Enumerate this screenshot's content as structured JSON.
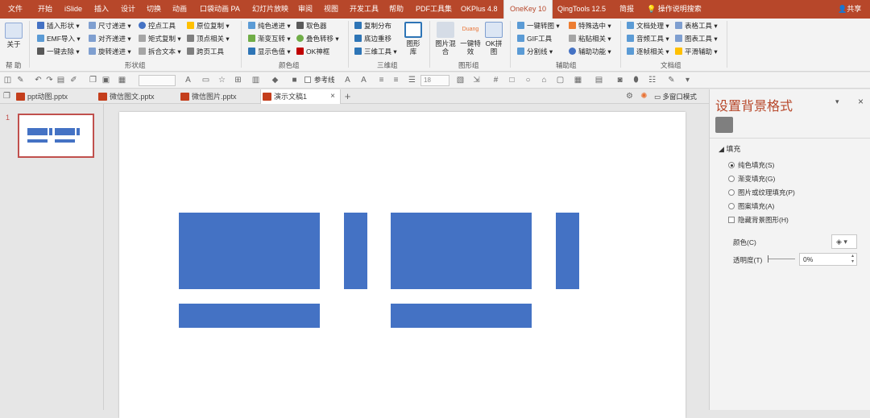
{
  "ribbon_tabs": [
    "文件",
    "开始",
    "iSlide",
    "插入",
    "设计",
    "切换",
    "动画",
    "口袋动画 PA",
    "幻灯片放映",
    "审阅",
    "视图",
    "开发工具",
    "帮助",
    "PDF工具集",
    "OKPlus 4.8",
    "OneKey 10",
    "QingTools 12.5",
    "简报"
  ],
  "active_tab": "OneKey 10",
  "tell_me": "操作说明搜索",
  "share": "共享",
  "colors": {
    "brand": "#b7472a",
    "shape_fill": "#4472c4",
    "slide_border": "#c0504d"
  },
  "groups": {
    "help": {
      "button": "关于",
      "label": "帮 助"
    },
    "shape": {
      "label": "形状组",
      "items": [
        "插入形状",
        "EMF导入",
        "一键去除",
        "尺寸递进",
        "对齐递进",
        "旋转递进",
        "控点工具",
        "矩式复制",
        "拆合文本",
        "原位复制",
        "顶点相关",
        "跨页工具"
      ]
    },
    "color": {
      "label": "颜色组",
      "items": [
        "纯色递进",
        "渐变互转",
        "显示色值",
        "取色器",
        "叠色转移",
        "OK神框"
      ]
    },
    "3d": {
      "label": "三维组",
      "items": [
        "复制分布",
        "底边重移",
        "三维工具"
      ],
      "big": "图形库"
    },
    "image": {
      "label": "图形组",
      "items": [
        "图片混合",
        "一键特效",
        "OK拼图"
      ],
      "duang": "Duang"
    },
    "assist": {
      "label": "辅助组",
      "items": [
        "一键转图",
        "GIF工具",
        "分割线",
        "特殊选中",
        "粘贴相关",
        "辅助功能"
      ]
    },
    "doc": {
      "label": "文档组",
      "items": [
        "文档处理",
        "音频工具",
        "逐帧相关",
        "表格工具",
        "图表工具",
        "平滑辅助"
      ]
    }
  },
  "qat": {
    "font_size": "18",
    "reference_line": "参考线"
  },
  "doc_tabs": [
    "ppt动图.pptx",
    "微信图文.pptx",
    "微信图片.pptx",
    "演示文稿1"
  ],
  "active_doc": "演示文稿1",
  "multi_window": "多窗口模式",
  "slide_number": "1",
  "format_pane": {
    "title": "设置背景格式",
    "section": "填充",
    "options": [
      "纯色填充(S)",
      "渐变填充(G)",
      "图片或纹理填充(P)",
      "图案填充(A)"
    ],
    "selected": "纯色填充(S)",
    "hide_bg": "隐藏背景图形(H)",
    "color_label": "颜色(C)",
    "transparency_label": "透明度(T)",
    "transparency_value": "0%"
  }
}
